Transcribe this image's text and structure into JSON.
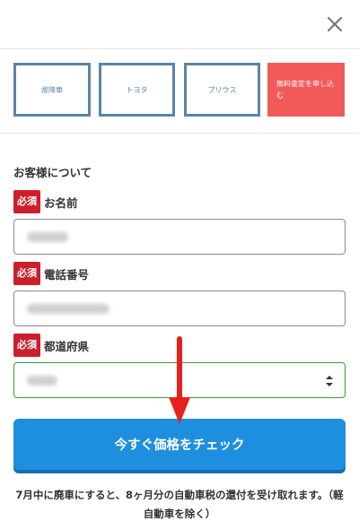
{
  "steps": [
    {
      "label": "故障車"
    },
    {
      "label": "トヨタ"
    },
    {
      "label": "プリウス"
    },
    {
      "label": "無料査定を申し込む"
    }
  ],
  "form": {
    "section_title": "お客様について",
    "required_badge": "必須",
    "name_label": "お名前",
    "phone_label": "電話番号",
    "prefecture_label": "都道府県"
  },
  "cta_label": "今すぐ価格をチェック",
  "note_text": "7月中に廃車にすると、8ヶ月分の自動車税の還付を受け取れます。（軽自動車を除く）",
  "colors": {
    "step_border": "#5a84a8",
    "step_active": "#f25a5a",
    "required": "#cc1f2c",
    "cta": "#1d8fde",
    "arrow": "#e8201c"
  }
}
